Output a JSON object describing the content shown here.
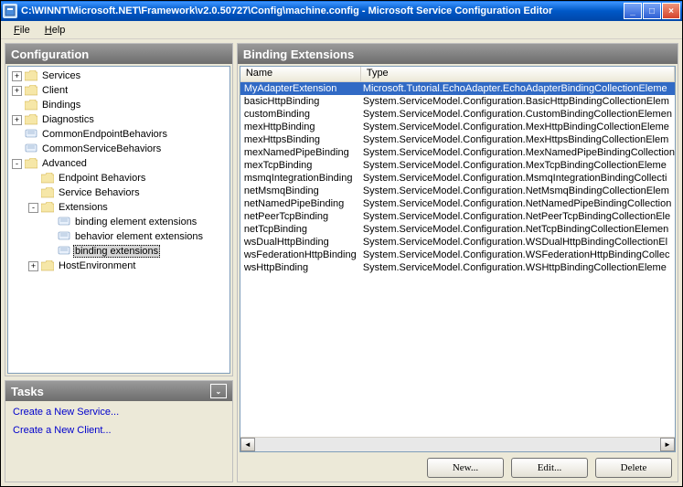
{
  "window": {
    "title": "C:\\WINNT\\Microsoft.NET\\Framework\\v2.0.50727\\Config\\machine.config - Microsoft Service Configuration Editor"
  },
  "menu": {
    "file": "File",
    "help": "Help"
  },
  "panels": {
    "config": "Configuration",
    "tasks": "Tasks",
    "right": "Binding Extensions"
  },
  "tree": [
    {
      "level": 0,
      "toggle": "+",
      "icon": "folder",
      "label": "Services"
    },
    {
      "level": 0,
      "toggle": "+",
      "icon": "folder",
      "label": "Client"
    },
    {
      "level": 0,
      "toggle": " ",
      "icon": "folder",
      "label": "Bindings"
    },
    {
      "level": 0,
      "toggle": "+",
      "icon": "folder",
      "label": "Diagnostics"
    },
    {
      "level": 0,
      "toggle": " ",
      "icon": "file",
      "label": "CommonEndpointBehaviors"
    },
    {
      "level": 0,
      "toggle": " ",
      "icon": "file",
      "label": "CommonServiceBehaviors"
    },
    {
      "level": 0,
      "toggle": "-",
      "icon": "folder",
      "label": "Advanced"
    },
    {
      "level": 1,
      "toggle": " ",
      "icon": "folder",
      "label": "Endpoint Behaviors"
    },
    {
      "level": 1,
      "toggle": " ",
      "icon": "folder",
      "label": "Service Behaviors"
    },
    {
      "level": 1,
      "toggle": "-",
      "icon": "folder",
      "label": "Extensions"
    },
    {
      "level": 2,
      "toggle": " ",
      "icon": "file",
      "label": "binding element extensions"
    },
    {
      "level": 2,
      "toggle": " ",
      "icon": "file",
      "label": "behavior element extensions"
    },
    {
      "level": 2,
      "toggle": " ",
      "icon": "file",
      "label": "binding extensions",
      "selected": true
    },
    {
      "level": 1,
      "toggle": "+",
      "icon": "folder",
      "label": "HostEnvironment"
    }
  ],
  "tasks": [
    "Create a New Service...",
    "Create a New Client..."
  ],
  "list": {
    "columns": {
      "name": "Name",
      "type": "Type"
    },
    "rows": [
      {
        "name": "MyAdapterExtension",
        "type": "Microsoft.Tutorial.EchoAdapter.EchoAdapterBindingCollectionEleme",
        "selected": true
      },
      {
        "name": "basicHttpBinding",
        "type": "System.ServiceModel.Configuration.BasicHttpBindingCollectionElem"
      },
      {
        "name": "customBinding",
        "type": "System.ServiceModel.Configuration.CustomBindingCollectionElemen"
      },
      {
        "name": "mexHttpBinding",
        "type": "System.ServiceModel.Configuration.MexHttpBindingCollectionEleme"
      },
      {
        "name": "mexHttpsBinding",
        "type": "System.ServiceModel.Configuration.MexHttpsBindingCollectionElem"
      },
      {
        "name": "mexNamedPipeBinding",
        "type": "System.ServiceModel.Configuration.MexNamedPipeBindingCollection"
      },
      {
        "name": "mexTcpBinding",
        "type": "System.ServiceModel.Configuration.MexTcpBindingCollectionEleme"
      },
      {
        "name": "msmqIntegrationBinding",
        "type": "System.ServiceModel.Configuration.MsmqIntegrationBindingCollecti"
      },
      {
        "name": "netMsmqBinding",
        "type": "System.ServiceModel.Configuration.NetMsmqBindingCollectionElem"
      },
      {
        "name": "netNamedPipeBinding",
        "type": "System.ServiceModel.Configuration.NetNamedPipeBindingCollection"
      },
      {
        "name": "netPeerTcpBinding",
        "type": "System.ServiceModel.Configuration.NetPeerTcpBindingCollectionEle"
      },
      {
        "name": "netTcpBinding",
        "type": "System.ServiceModel.Configuration.NetTcpBindingCollectionElemen"
      },
      {
        "name": "wsDualHttpBinding",
        "type": "System.ServiceModel.Configuration.WSDualHttpBindingCollectionEl"
      },
      {
        "name": "wsFederationHttpBinding",
        "type": "System.ServiceModel.Configuration.WSFederationHttpBindingCollec"
      },
      {
        "name": "wsHttpBinding",
        "type": "System.ServiceModel.Configuration.WSHttpBindingCollectionEleme"
      }
    ]
  },
  "buttons": {
    "new": "New...",
    "edit": "Edit...",
    "delete": "Delete"
  }
}
